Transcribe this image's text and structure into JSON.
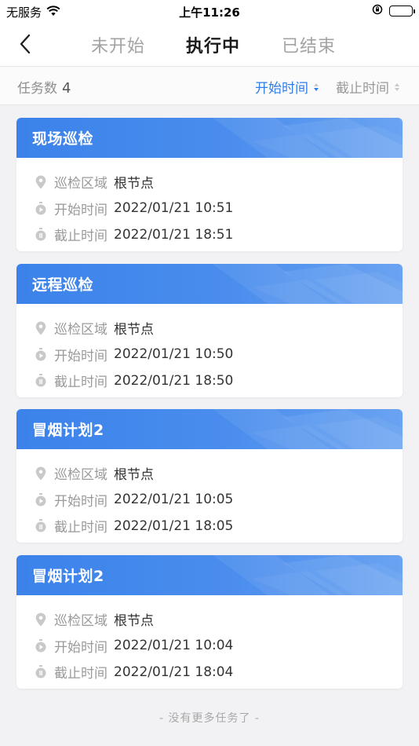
{
  "status": {
    "carrier": "无服务",
    "time": "上午11:26"
  },
  "nav": {
    "tabs": [
      {
        "label": "未开始",
        "active": false
      },
      {
        "label": "执行中",
        "active": true
      },
      {
        "label": "已结束",
        "active": false
      }
    ]
  },
  "filter": {
    "count_label": "任务数",
    "count": "4",
    "sort_start": "开始时间",
    "sort_end": "截止时间"
  },
  "labels": {
    "area": "巡检区域",
    "start": "开始时间",
    "end": "截止时间"
  },
  "tasks": [
    {
      "title": "现场巡检",
      "area": "根节点",
      "start": "2022/01/21 10:51",
      "end": "2022/01/21 18:51"
    },
    {
      "title": "远程巡检",
      "area": "根节点",
      "start": "2022/01/21 10:50",
      "end": "2022/01/21 18:50"
    },
    {
      "title": "冒烟计划2",
      "area": "根节点",
      "start": "2022/01/21 10:05",
      "end": "2022/01/21 18:05"
    },
    {
      "title": "冒烟计划2",
      "area": "根节点",
      "start": "2022/01/21 10:04",
      "end": "2022/01/21 18:04"
    }
  ],
  "footer": "- 没有更多任务了 -",
  "colors": {
    "accent": "#2f7ee8",
    "header_blue": "#3b82ea"
  }
}
